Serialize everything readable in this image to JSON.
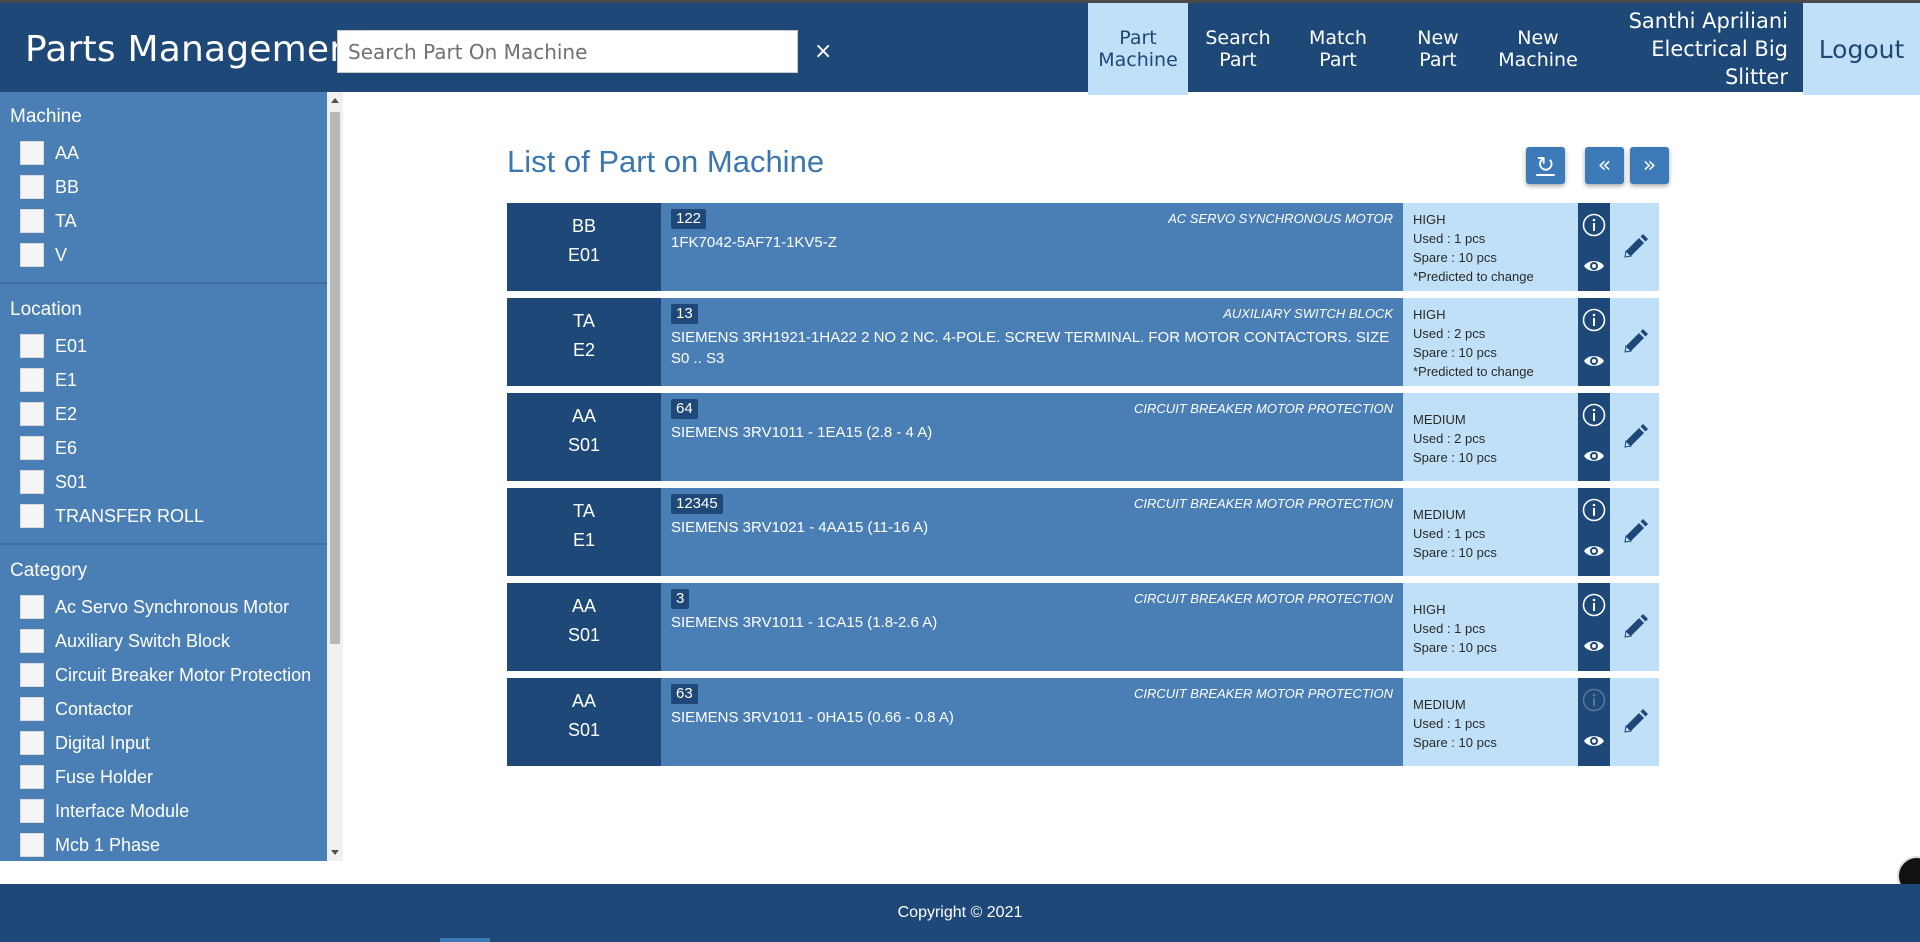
{
  "header": {
    "brand": "Parts Management",
    "search_placeholder": "Search Part On Machine",
    "clear_symbol": "×",
    "nav": [
      {
        "line1": "Part",
        "line2": "Machine",
        "active": true
      },
      {
        "line1": "Search",
        "line2": "Part",
        "active": false
      },
      {
        "line1": "Match",
        "line2": "Part",
        "active": false
      },
      {
        "line1": "New",
        "line2": "Part",
        "active": false
      },
      {
        "line1": "New",
        "line2": "Machine",
        "active": false
      }
    ],
    "user_name": "Santhi Apriliani",
    "user_dept": "Electrical Big Slitter",
    "logout": "Logout"
  },
  "sidebar": {
    "machine_title": "Machine",
    "machines": [
      "AA",
      "BB",
      "TA",
      "V"
    ],
    "location_title": "Location",
    "locations": [
      "E01",
      "E1",
      "E2",
      "E6",
      "S01",
      "TRANSFER ROLL"
    ],
    "category_title": "Category",
    "categories": [
      "Ac Servo Synchronous Motor",
      "Auxiliary Switch Block",
      "Circuit Breaker Motor Protection",
      "Contactor",
      "Digital Input",
      "Fuse Holder",
      "Interface Module",
      "Mcb 1 Phase"
    ]
  },
  "main": {
    "title": "List of Part on Machine",
    "refresh_symbol": "↻",
    "prev_symbol": "«",
    "next_symbol": "»",
    "parts": [
      {
        "machine": "BB",
        "location": "E01",
        "qty": "122",
        "category": "AC SERVO SYNCHRONOUS MOTOR",
        "name": "1FK7042-5AF71-1KV5-Z",
        "priority": "HIGH",
        "used": "Used : 1 pcs",
        "spare": "Spare : 10 pcs",
        "note": "*Predicted to change",
        "info_enabled": true
      },
      {
        "machine": "TA",
        "location": "E2",
        "qty": "13",
        "category": "AUXILIARY SWITCH BLOCK",
        "name": "SIEMENS 3RH1921-1HA22 2 NO 2 NC. 4-POLE. SCREW TERMINAL. FOR MOTOR CONTACTORS. SIZE S0 .. S3",
        "priority": "HIGH",
        "used": "Used : 2 pcs",
        "spare": "Spare : 10 pcs",
        "note": "*Predicted to change",
        "info_enabled": true
      },
      {
        "machine": "AA",
        "location": "S01",
        "qty": "64",
        "category": "CIRCUIT BREAKER MOTOR PROTECTION",
        "name": "SIEMENS 3RV1011 - 1EA15 (2.8 - 4 A)",
        "priority": "MEDIUM",
        "used": "Used : 2 pcs",
        "spare": "Spare : 10 pcs",
        "note": "",
        "info_enabled": true
      },
      {
        "machine": "TA",
        "location": "E1",
        "qty": "12345",
        "category": "CIRCUIT BREAKER MOTOR PROTECTION",
        "name": "SIEMENS 3RV1021 - 4AA15 (11-16 A)",
        "priority": "MEDIUM",
        "used": "Used : 1 pcs",
        "spare": "Spare : 10 pcs",
        "note": "",
        "info_enabled": true
      },
      {
        "machine": "AA",
        "location": "S01",
        "qty": "3",
        "category": "CIRCUIT BREAKER MOTOR PROTECTION",
        "name": "SIEMENS 3RV1011 - 1CA15 (1.8-2.6 A)",
        "priority": "HIGH",
        "used": "Used : 1 pcs",
        "spare": "Spare : 10 pcs",
        "note": "",
        "info_enabled": true
      },
      {
        "machine": "AA",
        "location": "S01",
        "qty": "63",
        "category": "CIRCUIT BREAKER MOTOR PROTECTION",
        "name": "SIEMENS 3RV1011 - 0HA15 (0.66 - 0.8 A)",
        "priority": "MEDIUM",
        "used": "Used : 1 pcs",
        "spare": "Spare : 10 pcs",
        "note": "",
        "info_enabled": false
      }
    ]
  },
  "footer": {
    "copyright": "Copyright © 2021"
  },
  "colors": {
    "navy": "#1d4878",
    "mid_blue": "#4a7fb5",
    "light_blue": "#bfe0f6",
    "title_blue": "#3a76b0"
  },
  "icons": {
    "info": "info-circle-icon",
    "view": "eye-icon",
    "edit": "pencil-icon",
    "refresh": "refresh-icon",
    "prev": "double-chevron-left-icon",
    "next": "double-chevron-right-icon"
  }
}
